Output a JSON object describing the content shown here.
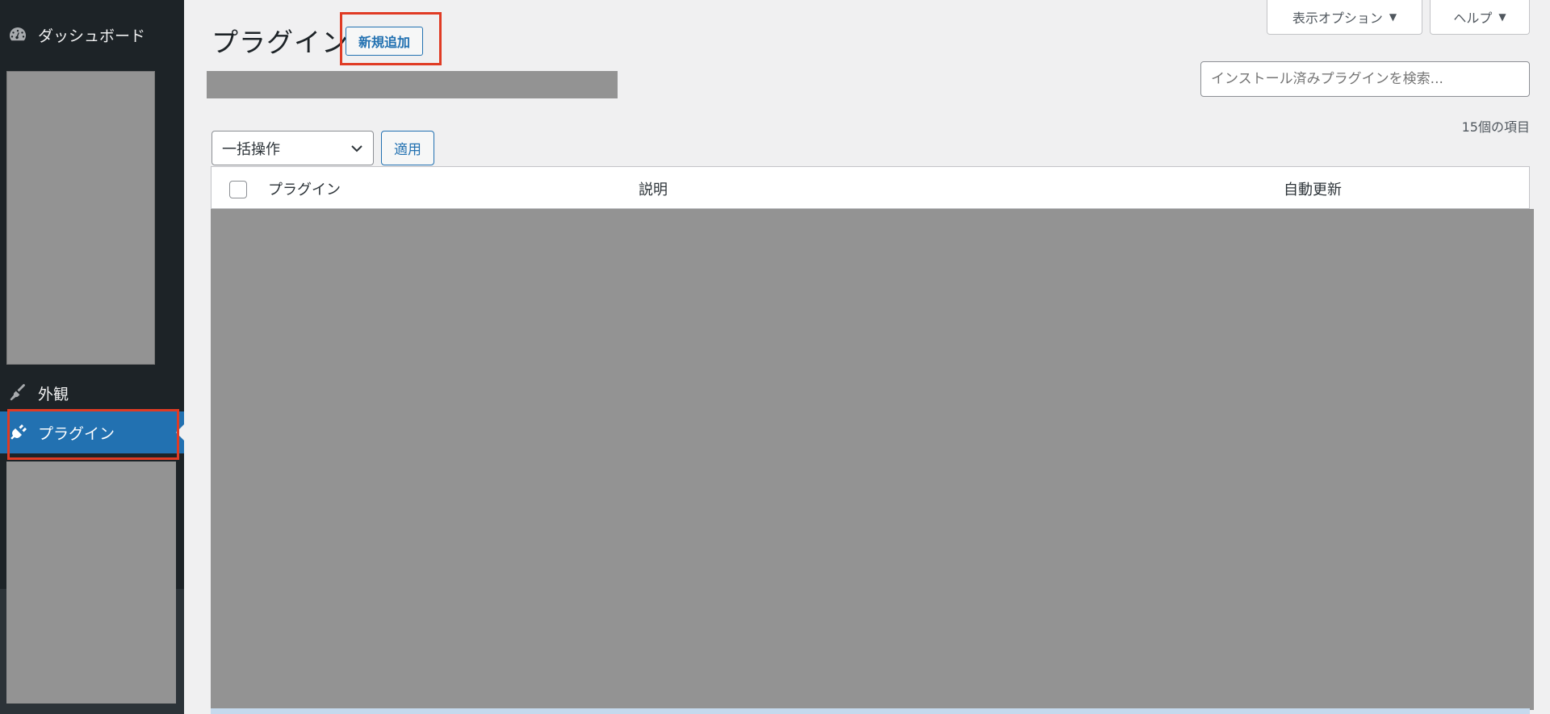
{
  "sidebar": {
    "items": [
      {
        "label": "ダッシュボード",
        "icon": "dashboard-icon"
      },
      {
        "label": "外観",
        "icon": "appearance-brush-icon"
      },
      {
        "label": "プラグイン",
        "icon": "plugin-icon",
        "active": true
      }
    ],
    "active_color": "#2271b1"
  },
  "header": {
    "title": "プラグイン",
    "add_new_label": "新規追加",
    "screen_options_label": "表示オプション",
    "help_label": "ヘルプ"
  },
  "search": {
    "placeholder": "インストール済みプラグインを検索..."
  },
  "toolbar": {
    "item_count": "15個の項目",
    "bulk_action_selected": "一括操作",
    "apply_label": "適用"
  },
  "table": {
    "columns": [
      "プラグイン",
      "説明",
      "自動更新"
    ]
  },
  "colors": {
    "highlight": "#e03b24",
    "redaction": "#939393",
    "accent": "#2271b1"
  }
}
